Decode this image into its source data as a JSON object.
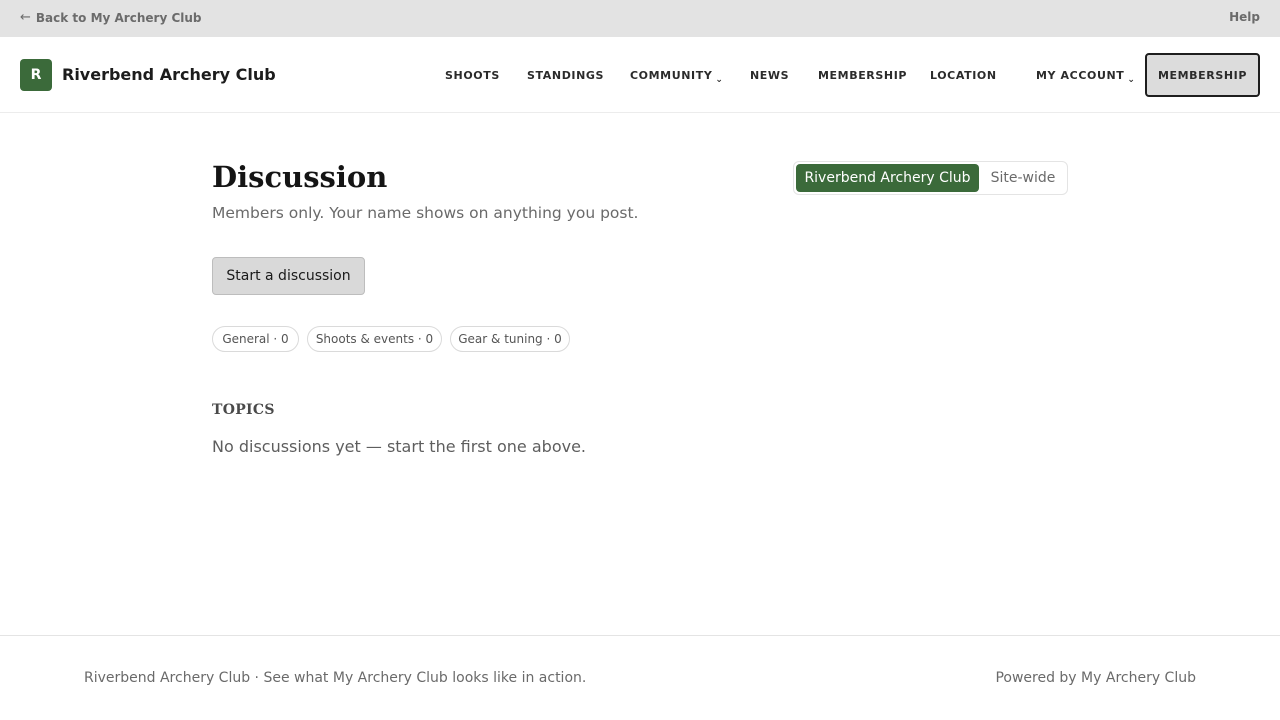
{
  "topbar": {
    "back_arrow": "←",
    "back_label": "Back to My Archery Club",
    "help_label": "Help"
  },
  "header": {
    "logo_letter": "R",
    "club_name": "Riverbend Archery Club",
    "nav": {
      "shoots": "SHOOTS",
      "standings": "STANDINGS",
      "community": "COMMUNITY",
      "news": "NEWS",
      "membership": "MEMBERSHIP",
      "location": "LOCATION",
      "my_account": "MY ACCOUNT"
    },
    "chevron": "⌄",
    "membership_button": "MEMBERSHIP"
  },
  "main": {
    "title": "Discussion",
    "subtitle": "Members only. Your name shows on anything you post.",
    "scope_toggle": {
      "active": "Riverbend Archery Club",
      "inactive": "Site-wide"
    },
    "start_button": "Start a discussion",
    "categories": [
      {
        "label": "General · 0"
      },
      {
        "label": "Shoots & events · 0"
      },
      {
        "label": "Gear & tuning · 0"
      }
    ],
    "topics_heading": "TOPICS",
    "empty_message": "No discussions yet — start the first one above."
  },
  "footer": {
    "left_text": "Riverbend Archery Club · See what My Archery Club looks like in action.",
    "right_text": "Powered by My Archery Club"
  },
  "colors": {
    "brand_green": "#3b6a3a",
    "topbar_bg": "#e3e3e3",
    "muted_text": "#6a6a6a"
  }
}
